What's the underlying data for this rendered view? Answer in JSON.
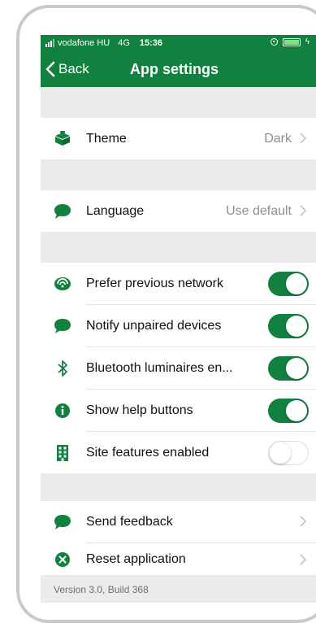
{
  "status_bar": {
    "carrier": "vodafone HU",
    "network": "4G",
    "time": "15:36"
  },
  "nav": {
    "back_label": "Back",
    "title": "App settings"
  },
  "settings": {
    "theme": {
      "label": "Theme",
      "value": "Dark",
      "icon": "paint-bucket-icon"
    },
    "language": {
      "label": "Language",
      "value": "Use default",
      "icon": "speech-bubble-icon"
    },
    "prefer_network": {
      "label": "Prefer previous network",
      "enabled": true,
      "icon": "network-icon"
    },
    "notify_unpaired": {
      "label": "Notify unpaired devices",
      "enabled": true,
      "icon": "speech-bubble-icon"
    },
    "bluetooth": {
      "label": "Bluetooth luminaires en...",
      "enabled": true,
      "icon": "bluetooth-icon"
    },
    "help_buttons": {
      "label": "Show help buttons",
      "enabled": true,
      "icon": "info-icon"
    },
    "site_features": {
      "label": "Site features enabled",
      "enabled": false,
      "icon": "building-icon"
    },
    "send_feedback": {
      "label": "Send feedback",
      "icon": "speech-bubble-icon"
    },
    "reset": {
      "label": "Reset application",
      "icon": "close-circle-icon"
    }
  },
  "footer": {
    "version": "Version 3.0, Build 368"
  },
  "colors": {
    "accent": "#12813f",
    "section_bg": "#ebebeb",
    "value_text": "#8e8e8e"
  }
}
